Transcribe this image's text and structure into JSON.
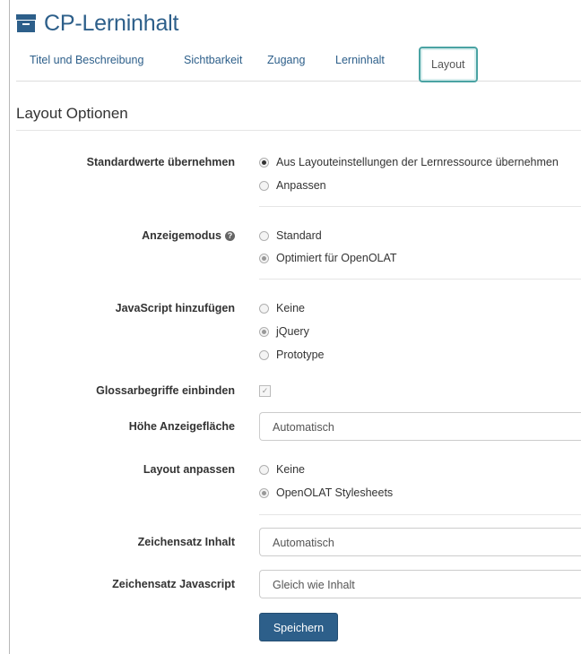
{
  "header": {
    "title": "CP-Lerninhalt",
    "icon": "archive-box-icon"
  },
  "tabs": [
    {
      "label": "Titel und Beschreibung"
    },
    {
      "label": "Sichtbarkeit"
    },
    {
      "label": "Zugang"
    },
    {
      "label": "Lerninhalt"
    },
    {
      "label": "Layout",
      "active": true
    }
  ],
  "section": {
    "title": "Layout Optionen"
  },
  "form": {
    "standardwerte": {
      "label": "Standardwerte übernehmen",
      "options": [
        {
          "label": "Aus Layouteinstellungen der Lernressource übernehmen",
          "selected": true
        },
        {
          "label": "Anpassen",
          "selected": false
        }
      ]
    },
    "anzeigemodus": {
      "label": "Anzeigemodus",
      "help_icon": "question-circle-icon",
      "options": [
        {
          "label": "Standard",
          "selected": false
        },
        {
          "label": "Optimiert für OpenOLAT",
          "selected": true
        }
      ]
    },
    "javascript": {
      "label": "JavaScript hinzufügen",
      "options": [
        {
          "label": "Keine",
          "selected": false
        },
        {
          "label": "jQuery",
          "selected": true
        },
        {
          "label": "Prototype",
          "selected": false
        }
      ]
    },
    "glossar": {
      "label": "Glossarbegriffe einbinden",
      "checked": true,
      "check_glyph": "✓"
    },
    "hoehe": {
      "label": "Höhe Anzeigefläche",
      "value": "Automatisch"
    },
    "layout_anpassen": {
      "label": "Layout anpassen",
      "options": [
        {
          "label": "Keine",
          "selected": false
        },
        {
          "label": "OpenOLAT Stylesheets",
          "selected": true
        }
      ]
    },
    "zeichensatz_inhalt": {
      "label": "Zeichensatz Inhalt",
      "value": "Automatisch"
    },
    "zeichensatz_js": {
      "label": "Zeichensatz Javascript",
      "value": "Gleich wie Inhalt"
    },
    "save_label": "Speichern"
  },
  "colors": {
    "brand": "#2d5f8a",
    "active_tab_border": "#4aa3a3"
  }
}
